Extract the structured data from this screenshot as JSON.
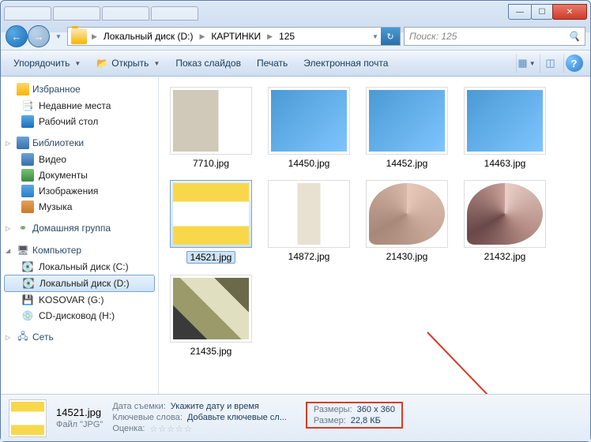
{
  "window": {
    "min": "—",
    "max": "☐",
    "close": "✕"
  },
  "breadcrumbs": [
    "Локальный диск (D:)",
    "КАРТИНКИ",
    "125"
  ],
  "search": {
    "placeholder": "Поиск: 125"
  },
  "toolbar": {
    "organize": "Упорядочить",
    "open": "Открыть",
    "slideshow": "Показ слайдов",
    "print": "Печать",
    "email": "Электронная почта",
    "help": "?"
  },
  "sidebar": {
    "favorites": {
      "label": "Избранное",
      "items": [
        "Недавние места",
        "Рабочий стол"
      ]
    },
    "libraries": {
      "label": "Библиотеки",
      "items": [
        "Видео",
        "Документы",
        "Изображения",
        "Музыка"
      ]
    },
    "homegroup": {
      "label": "Домашняя группа"
    },
    "computer": {
      "label": "Компьютер",
      "items": [
        "Локальный диск (C:)",
        "Локальный диск (D:)",
        "KOSOVAR (G:)",
        "CD-дисковод (H:)"
      ],
      "selected_index": 1
    },
    "network": {
      "label": "Сеть"
    }
  },
  "files": [
    {
      "name": "7710.jpg",
      "style": "prod-echo"
    },
    {
      "name": "14450.jpg",
      "style": "prod-blue"
    },
    {
      "name": "14452.jpg",
      "style": "prod-blue"
    },
    {
      "name": "14463.jpg",
      "style": "prod-blue"
    },
    {
      "name": "14521.jpg",
      "style": "prod-yellow",
      "selected": true
    },
    {
      "name": "14872.jpg",
      "style": "prod-white"
    },
    {
      "name": "21430.jpg",
      "style": "prod-palette1"
    },
    {
      "name": "21432.jpg",
      "style": "prod-palette2"
    },
    {
      "name": "21435.jpg",
      "style": "prod-palette3"
    }
  ],
  "details": {
    "filename": "14521.jpg",
    "filetype": "Файл \"JPG\"",
    "date_label": "Дата съемки:",
    "date_value": "Укажите дату и время",
    "keywords_label": "Ключевые слова:",
    "keywords_value": "Добавьте ключевые сл...",
    "rating_label": "Оценка:",
    "rating_value": "☆☆☆☆☆",
    "dims_label": "Размеры:",
    "dims_value": "360 x 360",
    "size_label": "Размер:",
    "size_value": "22,8 КБ"
  }
}
